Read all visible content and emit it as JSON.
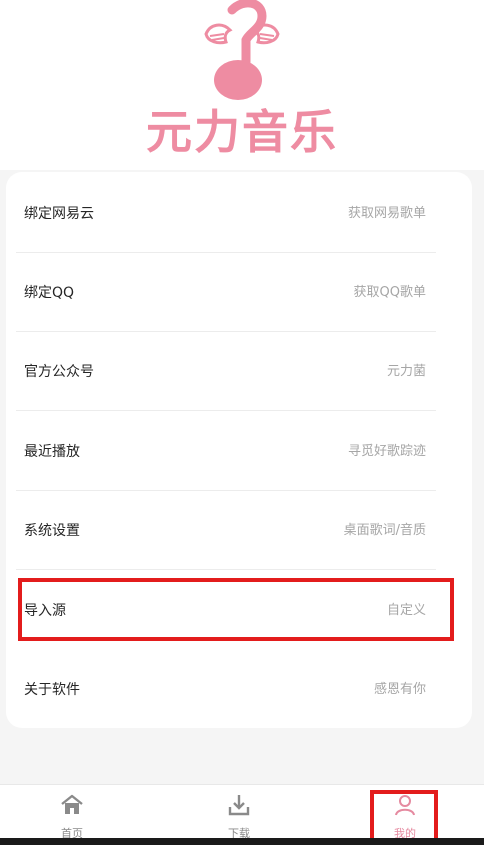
{
  "app": {
    "logo_text": "元力音乐"
  },
  "menu": [
    {
      "label": "绑定网易云",
      "value": "获取网易歌单"
    },
    {
      "label": "绑定QQ",
      "value": "获取QQ歌单"
    },
    {
      "label": "官方公众号",
      "value": "元力菌"
    },
    {
      "label": "最近播放",
      "value": "寻觅好歌踪迹"
    },
    {
      "label": "系统设置",
      "value": "桌面歌词/音质"
    },
    {
      "label": "导入源",
      "value": "自定义"
    },
    {
      "label": "关于软件",
      "value": "感恩有你"
    }
  ],
  "tabbar": {
    "tabs": [
      {
        "label": "首页",
        "icon": "home-icon"
      },
      {
        "label": "下载",
        "icon": "download-icon"
      },
      {
        "label": "我的",
        "icon": "user-icon",
        "active": true
      }
    ]
  },
  "colors": {
    "brand": "#ee8ca2",
    "highlight": "#e31c1c"
  }
}
